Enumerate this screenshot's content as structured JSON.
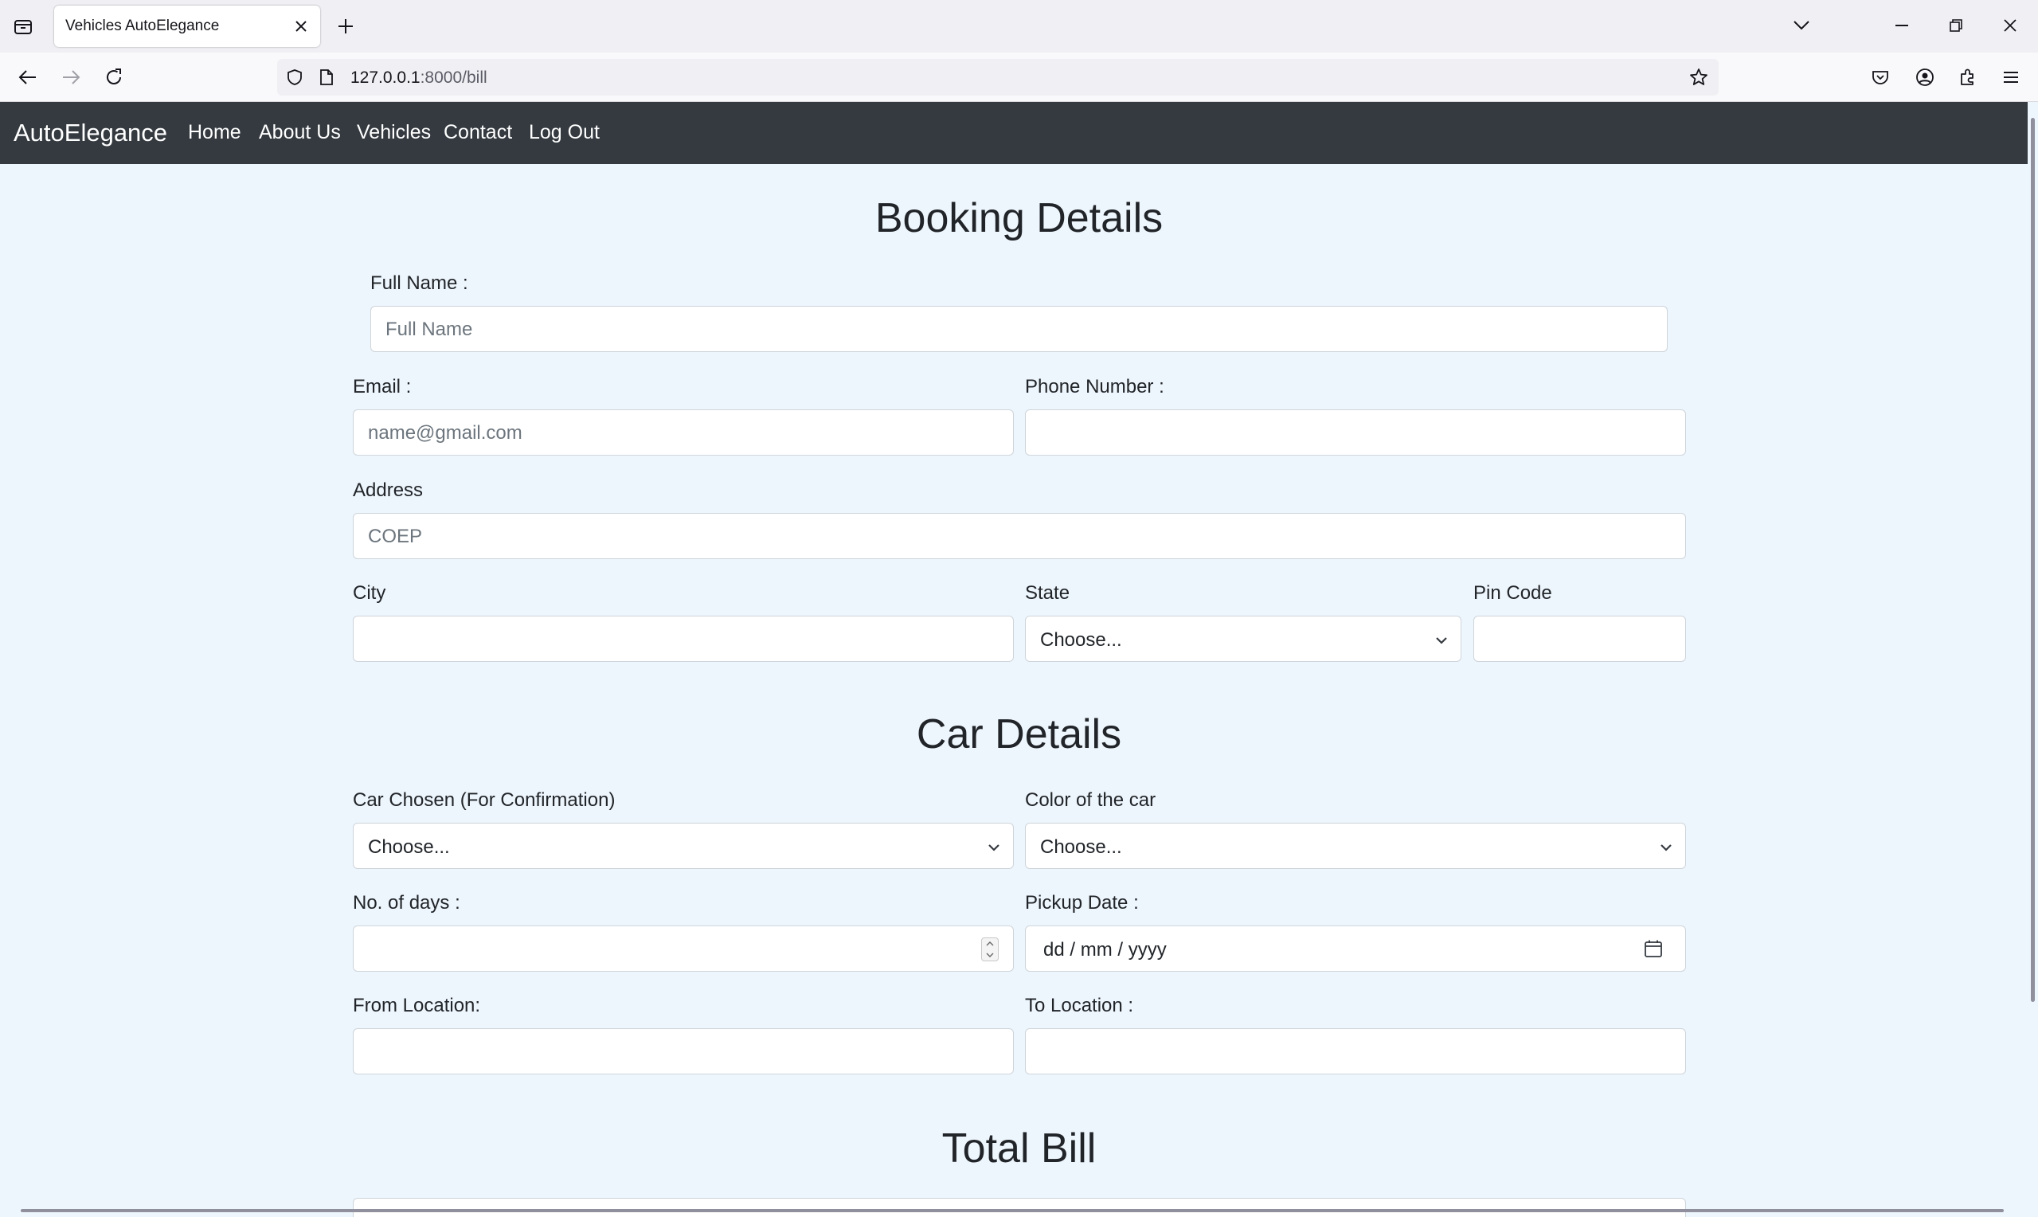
{
  "browser": {
    "tab_title": "Vehicles AutoElegance",
    "url_host": "127.0.0.1",
    "url_rest": ":8000/bill"
  },
  "site": {
    "brand": "AutoElegance",
    "nav": [
      "Home",
      "About Us",
      "Vehicles",
      "Contact",
      "Log Out"
    ]
  },
  "booking": {
    "title": "Booking Details",
    "full_name_label": "Full Name :",
    "full_name_placeholder": "Full Name",
    "email_label": "Email :",
    "email_placeholder": "name@gmail.com",
    "phone_label": "Phone Number :",
    "address_label": "Address",
    "address_placeholder": "COEP",
    "city_label": "City",
    "state_label": "State",
    "state_selected": "Choose...",
    "pin_label": "Pin Code"
  },
  "car": {
    "title": "Car Details",
    "car_label": "Car Chosen (For Confirmation)",
    "car_selected": "Choose...",
    "color_label": "Color of the car",
    "color_selected": "Choose...",
    "days_label": "No. of days :",
    "pickup_label": "Pickup Date :",
    "pickup_placeholder": "dd / mm / yyyy",
    "from_label": "From Location:",
    "to_label": "To Location :"
  },
  "bill": {
    "title": "Total Bill"
  }
}
